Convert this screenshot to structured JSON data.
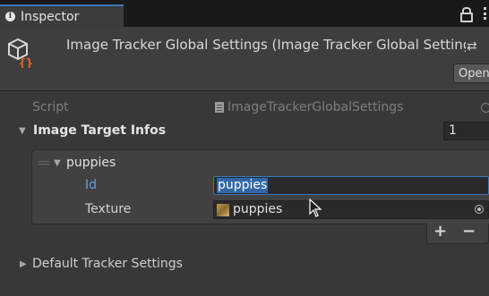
{
  "tab": {
    "label": "Inspector",
    "icon": "info-icon"
  },
  "header": {
    "title": "Image Tracker Global Settings (Image Tracker Global Settings)",
    "open_label": "Open",
    "settings_glyph": "⇄"
  },
  "script_row": {
    "label": "Script",
    "value": "ImageTrackerGlobalSettings"
  },
  "list": {
    "label": "Image Target Infos",
    "size": "1",
    "element": {
      "label": "puppies",
      "fields": [
        {
          "label": "Id",
          "value": "puppies"
        },
        {
          "label": "Texture",
          "value": "puppies"
        }
      ]
    },
    "add_label": "+",
    "remove_label": "−"
  },
  "default_settings": {
    "label": "Default Tracker Settings"
  },
  "colors": {
    "background": "#383838",
    "selection": "#3268a8",
    "focus_border": "#3a79bb",
    "id_label": "#5ea0e0"
  }
}
